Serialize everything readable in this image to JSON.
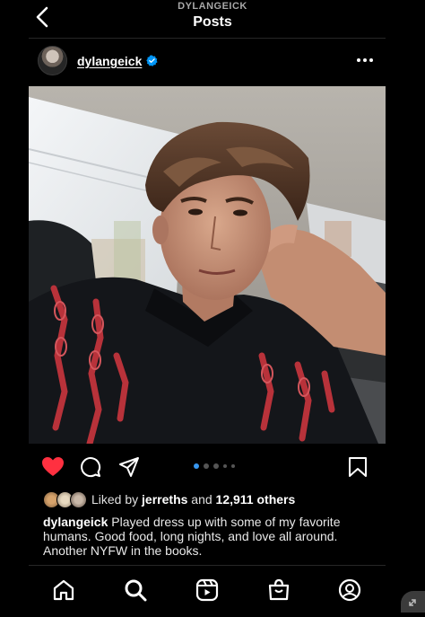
{
  "header": {
    "account_handle": "DYLANGEICK",
    "title": "Posts"
  },
  "post": {
    "username": "dylangeick",
    "verified": true,
    "carousel": {
      "total": 5,
      "active_index": 0
    },
    "likes": {
      "prefix": "Liked by ",
      "liker": "jerreths",
      "middle": " and ",
      "count_text": "12,911 others"
    },
    "caption": {
      "username": "dylangeick",
      "text": " Played dress up with some of my favorite humans. Good food, long nights, and love all around. Another NYFW in the books."
    },
    "liked": true
  },
  "colors": {
    "background": "#000000",
    "like_red": "#ff3040",
    "verified_blue": "#0095f6",
    "carousel_active": "#3897f0"
  },
  "icons": {
    "back": "chevron-left-icon",
    "more": "more-horizontal-icon",
    "like": "heart-filled-icon",
    "comment": "comment-icon",
    "share": "paper-plane-icon",
    "save": "bookmark-icon",
    "nav": [
      "home-icon",
      "search-icon",
      "reels-icon",
      "shop-icon",
      "profile-icon"
    ]
  }
}
